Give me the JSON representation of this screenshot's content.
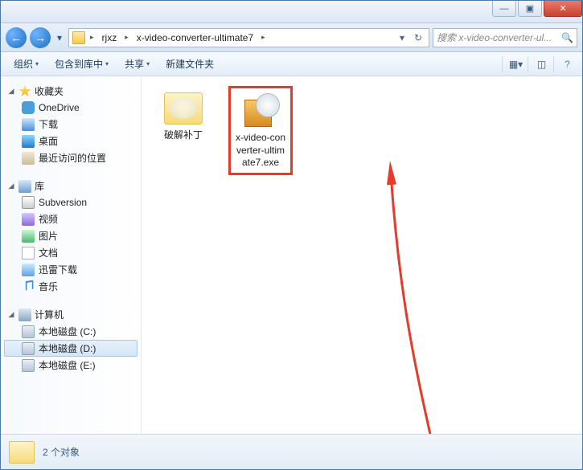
{
  "breadcrumbs": {
    "sep": "▸",
    "seg1": "rjxz",
    "seg2": "x-video-converter-ultimate7"
  },
  "search": {
    "placeholder": "搜索 x-video-converter-ul...",
    "icon": "🔍"
  },
  "toolbar": {
    "organize": "组织",
    "include": "包含到库中",
    "share": "共享",
    "newfolder": "新建文件夹",
    "dd": "▾"
  },
  "sidebar": {
    "fav": "收藏夹",
    "onedrive": "OneDrive",
    "downloads": "下载",
    "desktop": "桌面",
    "recent": "最近访问的位置",
    "lib": "库",
    "svn": "Subversion",
    "video": "视频",
    "pictures": "图片",
    "documents": "文档",
    "xunlei": "迅雷下载",
    "music": "音乐",
    "computer": "计算机",
    "driveC": "本地磁盘 (C:)",
    "driveD": "本地磁盘 (D:)",
    "driveE": "本地磁盘 (E:)",
    "tw_open": "◢",
    "tw_closed": "▷"
  },
  "files": {
    "item1": "破解补丁",
    "item2": "x-video-converter-ultimate7.exe"
  },
  "status": {
    "count": "2 个对象"
  },
  "winbtn": {
    "min": "—",
    "max": "▣",
    "close": "✕"
  },
  "nav": {
    "back": "←",
    "fwd": "→",
    "dd": "▾",
    "refresh": "↻",
    "hist": "▾"
  }
}
